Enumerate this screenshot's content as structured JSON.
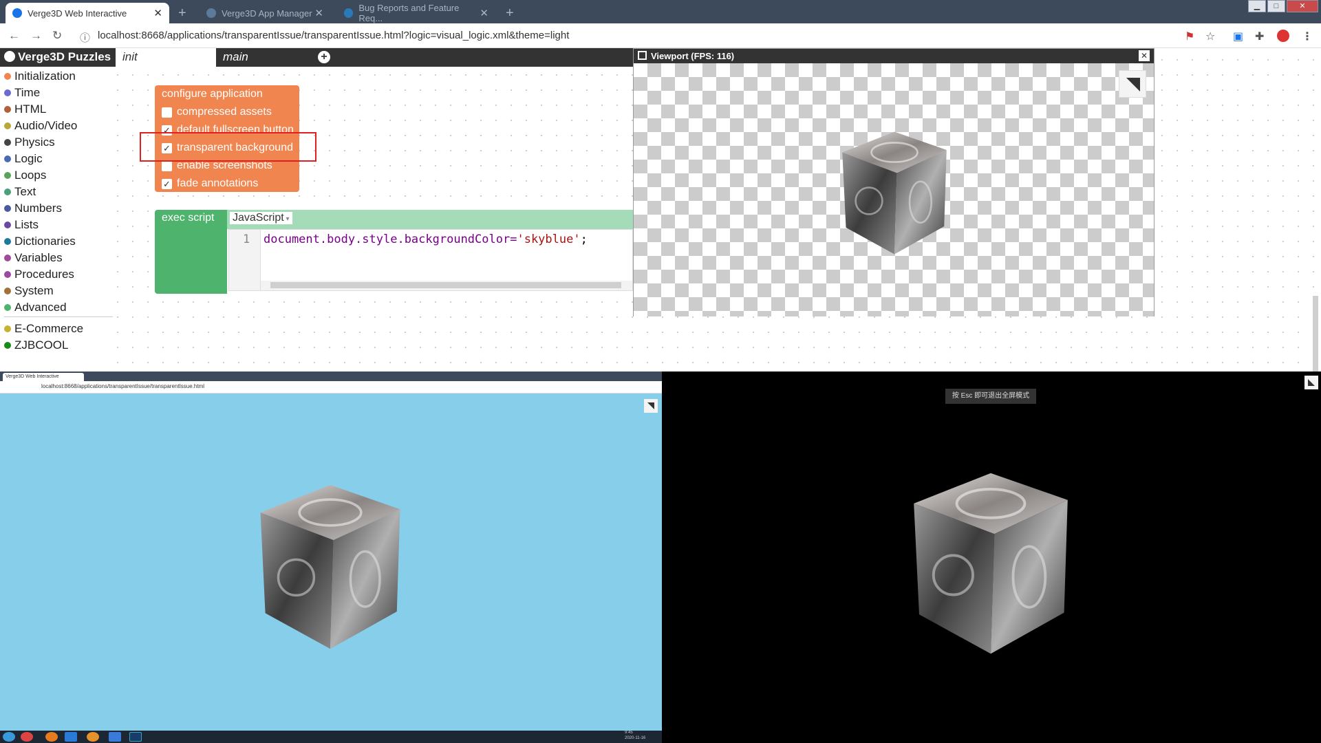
{
  "browser": {
    "tabs": [
      {
        "label": "Verge3D Web Interactive",
        "active": true
      },
      {
        "label": "Verge3D App Manager",
        "active": false
      },
      {
        "label": "Bug Reports and Feature Req...",
        "active": false
      }
    ],
    "url": "localhost:8668/applications/transparentIssue/transparentIssue.html?logic=visual_logic.xml&theme=light"
  },
  "puzzles": {
    "brand": "Verge3D Puzzles",
    "workspace_tabs": [
      "init",
      "main"
    ],
    "categories": [
      {
        "label": "Initialization",
        "color": "#f0854f"
      },
      {
        "label": "Time",
        "color": "#6a6ad0"
      },
      {
        "label": "HTML",
        "color": "#b0603a"
      },
      {
        "label": "Audio/Video",
        "color": "#b8a83a"
      },
      {
        "label": "Physics",
        "color": "#444444"
      },
      {
        "label": "Logic",
        "color": "#4b6bb0"
      },
      {
        "label": "Loops",
        "color": "#5ba35b"
      },
      {
        "label": "Text",
        "color": "#4ba07a"
      },
      {
        "label": "Numbers",
        "color": "#4a5a9a"
      },
      {
        "label": "Lists",
        "color": "#6a4aa0"
      },
      {
        "label": "Dictionaries",
        "color": "#1f7a9a"
      },
      {
        "label": "Variables",
        "color": "#a04a9a"
      },
      {
        "label": "Procedures",
        "color": "#9a4aa0"
      },
      {
        "label": "System",
        "color": "#a0723a"
      },
      {
        "label": "Advanced",
        "color": "#4db36d"
      },
      {
        "label": "E-Commerce",
        "color": "#c8b030"
      },
      {
        "label": "ZJBCOOL",
        "color": "#1a8a1a"
      }
    ],
    "config_block": {
      "title": "configure application",
      "options": [
        {
          "label": "compressed assets",
          "checked": false
        },
        {
          "label": "default fullscreen button",
          "checked": true
        },
        {
          "label": "transparent background",
          "checked": true
        },
        {
          "label": "enable screenshots",
          "checked": false
        },
        {
          "label": "fade annotations",
          "checked": true
        }
      ]
    },
    "exec_block": {
      "label": "exec script",
      "language": "JavaScript",
      "line_number": "1",
      "code_obj": "document.body.style.backgroundColor=",
      "code_str": "'skyblue'",
      "code_end": ";"
    }
  },
  "viewport": {
    "title": "Viewport (FPS: 116)"
  },
  "bottom_left": {
    "tab_label": "Verge3D Web Interactive",
    "url": "localhost:8668/applications/transparentIssue/transparentIssue.html",
    "background": "#87ceeb"
  },
  "bottom_right": {
    "esc_note": "按 Esc 即可退出全屏模式",
    "background": "#000000"
  },
  "taskbar": {
    "time": "9:45",
    "date": "2020-11-16"
  }
}
